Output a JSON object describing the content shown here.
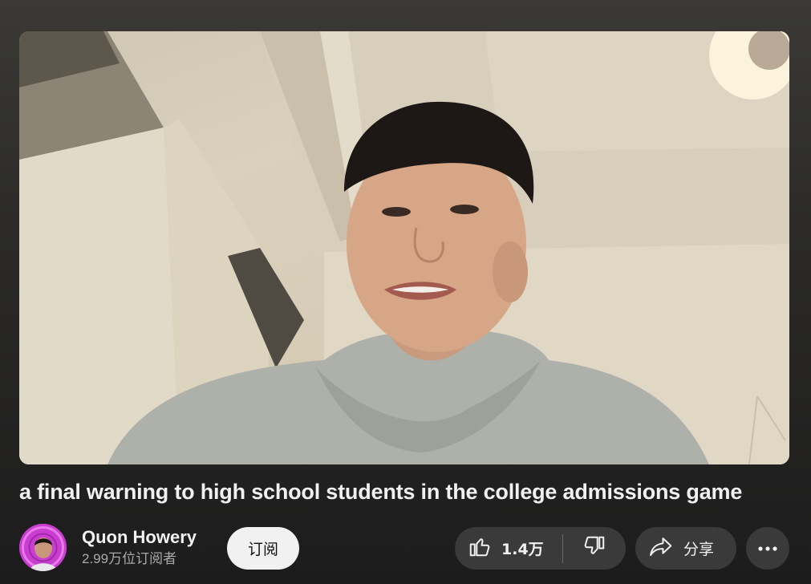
{
  "video": {
    "title": "a final warning to high school students in the college admissions game"
  },
  "channel": {
    "name": "Quon Howery",
    "subscribers": "2.99万位订阅者"
  },
  "actions": {
    "subscribe_label": "订阅",
    "like_count": "1.4万",
    "share_label": "分享"
  },
  "icons": {
    "like": "thumbs-up-icon",
    "dislike": "thumbs-down-icon",
    "share": "share-arrow-icon",
    "more": "more-horizontal-icon"
  },
  "colors": {
    "subscribe_bg": "#f1f1f1",
    "pill_bg": "#3a3a3a",
    "text_primary": "#f1f1f1",
    "text_secondary": "#aaaaaa"
  }
}
